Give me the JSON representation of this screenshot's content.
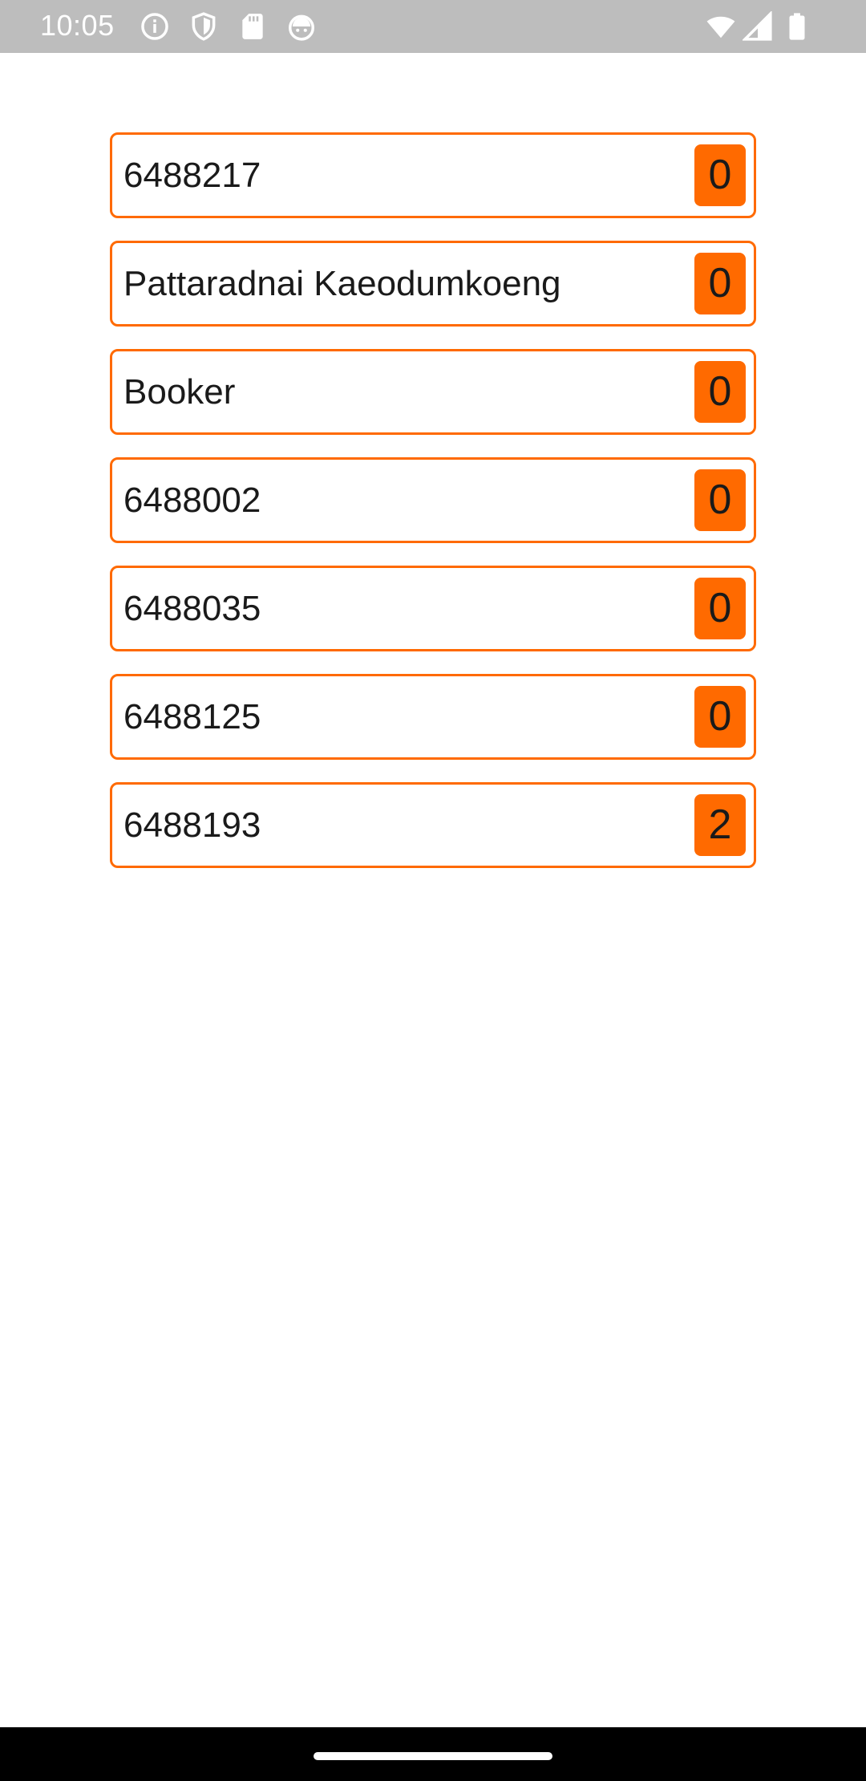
{
  "status_bar": {
    "time": "10:05",
    "left_icons": [
      "info-icon",
      "shield-icon",
      "sd-card-icon",
      "android-debug-icon"
    ],
    "right_icons": [
      "wifi-icon",
      "cell-signal-icon",
      "battery-icon"
    ]
  },
  "list": {
    "items": [
      {
        "label": "6488217",
        "count": "0"
      },
      {
        "label": "Pattaradnai Kaeodumkoeng",
        "count": "0"
      },
      {
        "label": "Booker",
        "count": "0"
      },
      {
        "label": "6488002",
        "count": "0"
      },
      {
        "label": "6488035",
        "count": "0"
      },
      {
        "label": "6488125",
        "count": "0"
      },
      {
        "label": "6488193",
        "count": "2"
      }
    ]
  },
  "colors": {
    "accent": "#ff6a00",
    "status_bar": "#bdbdbd",
    "nav_bar": "#000000"
  }
}
